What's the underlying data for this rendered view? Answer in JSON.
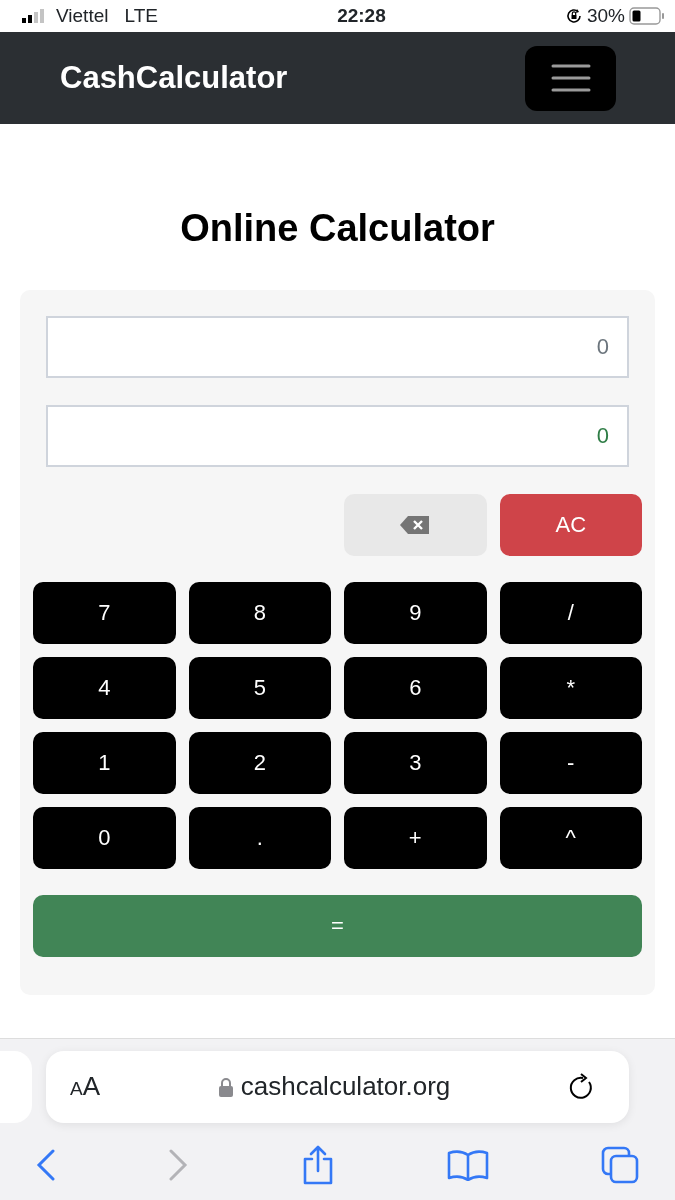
{
  "status_bar": {
    "carrier": "Viettel",
    "network": "LTE",
    "time": "22:28",
    "battery": "30%"
  },
  "navbar": {
    "brand": "CashCalculator"
  },
  "title": "Online Calculator",
  "displays": [
    {
      "kind": "expression",
      "value": "0"
    },
    {
      "kind": "result",
      "value": "0"
    }
  ],
  "actions": [
    {
      "kind": "backspace"
    },
    {
      "kind": "clear",
      "label": "AC"
    }
  ],
  "keys": [
    "7",
    "8",
    "9",
    "/",
    "4",
    "5",
    "6",
    "*",
    "1",
    "2",
    "3",
    "-",
    "0",
    ".",
    "+",
    "^"
  ],
  "equals": "=",
  "browser": {
    "text_size": "AA",
    "url": "cashcalculator.org"
  }
}
